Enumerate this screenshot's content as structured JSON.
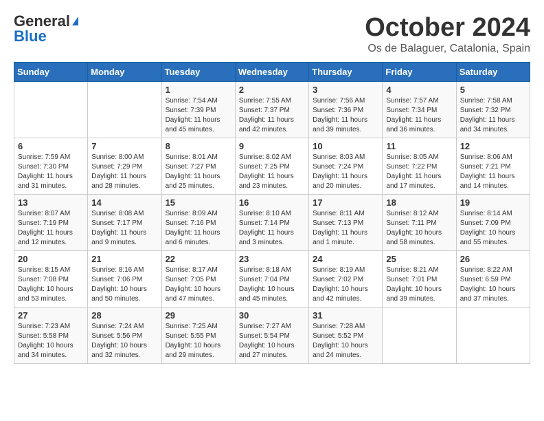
{
  "logo": {
    "general": "General",
    "blue": "Blue"
  },
  "title": "October 2024",
  "location": "Os de Balaguer, Catalonia, Spain",
  "days_of_week": [
    "Sunday",
    "Monday",
    "Tuesday",
    "Wednesday",
    "Thursday",
    "Friday",
    "Saturday"
  ],
  "weeks": [
    [
      {
        "day": "",
        "info": ""
      },
      {
        "day": "",
        "info": ""
      },
      {
        "day": "1",
        "info": "Sunrise: 7:54 AM\nSunset: 7:39 PM\nDaylight: 11 hours and 45 minutes."
      },
      {
        "day": "2",
        "info": "Sunrise: 7:55 AM\nSunset: 7:37 PM\nDaylight: 11 hours and 42 minutes."
      },
      {
        "day": "3",
        "info": "Sunrise: 7:56 AM\nSunset: 7:36 PM\nDaylight: 11 hours and 39 minutes."
      },
      {
        "day": "4",
        "info": "Sunrise: 7:57 AM\nSunset: 7:34 PM\nDaylight: 11 hours and 36 minutes."
      },
      {
        "day": "5",
        "info": "Sunrise: 7:58 AM\nSunset: 7:32 PM\nDaylight: 11 hours and 34 minutes."
      }
    ],
    [
      {
        "day": "6",
        "info": "Sunrise: 7:59 AM\nSunset: 7:30 PM\nDaylight: 11 hours and 31 minutes."
      },
      {
        "day": "7",
        "info": "Sunrise: 8:00 AM\nSunset: 7:29 PM\nDaylight: 11 hours and 28 minutes."
      },
      {
        "day": "8",
        "info": "Sunrise: 8:01 AM\nSunset: 7:27 PM\nDaylight: 11 hours and 25 minutes."
      },
      {
        "day": "9",
        "info": "Sunrise: 8:02 AM\nSunset: 7:25 PM\nDaylight: 11 hours and 23 minutes."
      },
      {
        "day": "10",
        "info": "Sunrise: 8:03 AM\nSunset: 7:24 PM\nDaylight: 11 hours and 20 minutes."
      },
      {
        "day": "11",
        "info": "Sunrise: 8:05 AM\nSunset: 7:22 PM\nDaylight: 11 hours and 17 minutes."
      },
      {
        "day": "12",
        "info": "Sunrise: 8:06 AM\nSunset: 7:21 PM\nDaylight: 11 hours and 14 minutes."
      }
    ],
    [
      {
        "day": "13",
        "info": "Sunrise: 8:07 AM\nSunset: 7:19 PM\nDaylight: 11 hours and 12 minutes."
      },
      {
        "day": "14",
        "info": "Sunrise: 8:08 AM\nSunset: 7:17 PM\nDaylight: 11 hours and 9 minutes."
      },
      {
        "day": "15",
        "info": "Sunrise: 8:09 AM\nSunset: 7:16 PM\nDaylight: 11 hours and 6 minutes."
      },
      {
        "day": "16",
        "info": "Sunrise: 8:10 AM\nSunset: 7:14 PM\nDaylight: 11 hours and 3 minutes."
      },
      {
        "day": "17",
        "info": "Sunrise: 8:11 AM\nSunset: 7:13 PM\nDaylight: 11 hours and 1 minute."
      },
      {
        "day": "18",
        "info": "Sunrise: 8:12 AM\nSunset: 7:11 PM\nDaylight: 10 hours and 58 minutes."
      },
      {
        "day": "19",
        "info": "Sunrise: 8:14 AM\nSunset: 7:09 PM\nDaylight: 10 hours and 55 minutes."
      }
    ],
    [
      {
        "day": "20",
        "info": "Sunrise: 8:15 AM\nSunset: 7:08 PM\nDaylight: 10 hours and 53 minutes."
      },
      {
        "day": "21",
        "info": "Sunrise: 8:16 AM\nSunset: 7:06 PM\nDaylight: 10 hours and 50 minutes."
      },
      {
        "day": "22",
        "info": "Sunrise: 8:17 AM\nSunset: 7:05 PM\nDaylight: 10 hours and 47 minutes."
      },
      {
        "day": "23",
        "info": "Sunrise: 8:18 AM\nSunset: 7:04 PM\nDaylight: 10 hours and 45 minutes."
      },
      {
        "day": "24",
        "info": "Sunrise: 8:19 AM\nSunset: 7:02 PM\nDaylight: 10 hours and 42 minutes."
      },
      {
        "day": "25",
        "info": "Sunrise: 8:21 AM\nSunset: 7:01 PM\nDaylight: 10 hours and 39 minutes."
      },
      {
        "day": "26",
        "info": "Sunrise: 8:22 AM\nSunset: 6:59 PM\nDaylight: 10 hours and 37 minutes."
      }
    ],
    [
      {
        "day": "27",
        "info": "Sunrise: 7:23 AM\nSunset: 5:58 PM\nDaylight: 10 hours and 34 minutes."
      },
      {
        "day": "28",
        "info": "Sunrise: 7:24 AM\nSunset: 5:56 PM\nDaylight: 10 hours and 32 minutes."
      },
      {
        "day": "29",
        "info": "Sunrise: 7:25 AM\nSunset: 5:55 PM\nDaylight: 10 hours and 29 minutes."
      },
      {
        "day": "30",
        "info": "Sunrise: 7:27 AM\nSunset: 5:54 PM\nDaylight: 10 hours and 27 minutes."
      },
      {
        "day": "31",
        "info": "Sunrise: 7:28 AM\nSunset: 5:52 PM\nDaylight: 10 hours and 24 minutes."
      },
      {
        "day": "",
        "info": ""
      },
      {
        "day": "",
        "info": ""
      }
    ]
  ]
}
